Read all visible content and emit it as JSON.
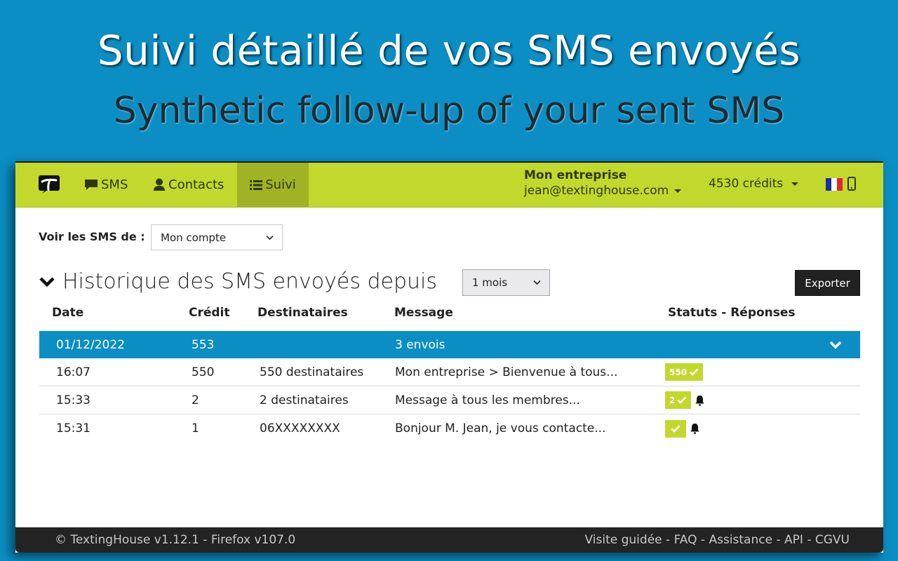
{
  "banner": {
    "title_fr": "Suivi détaillé de vos SMS envoyés",
    "title_en": "Synthetic follow-up of your sent SMS"
  },
  "navbar": {
    "logo": "textinghouse-logo",
    "items": [
      {
        "label": "SMS",
        "icon": "comment-icon",
        "active": false
      },
      {
        "label": "Contacts",
        "icon": "user-icon",
        "active": false
      },
      {
        "label": "Suivi",
        "icon": "list-icon",
        "active": true
      }
    ],
    "account": {
      "company": "Mon entreprise",
      "email": "jean@textinghouse.com"
    },
    "credits": "4530 crédits",
    "language_flag": "france-flag-icon",
    "mobile_icon": "mobile-phone-icon"
  },
  "filter": {
    "label": "Voir les SMS de :",
    "selected": "Mon compte"
  },
  "history": {
    "title": "Historique des SMS envoyés depuis",
    "period_selected": "1 mois",
    "export_label": "Exporter",
    "columns": [
      "Date",
      "Crédit",
      "Destinataires",
      "Message",
      "Statuts - Réponses"
    ],
    "group": {
      "date": "01/12/2022",
      "credit": "553",
      "message": "3 envois"
    },
    "rows": [
      {
        "time": "16:07",
        "credit": "550",
        "recipients": "550 destinataires",
        "message": "Mon entreprise > Bienvenue à tous...",
        "status_count": "550",
        "has_reply": false
      },
      {
        "time": "15:33",
        "credit": "2",
        "recipients": "2 destinataires",
        "message": "Message à tous les membres...",
        "status_count": "2",
        "has_reply": true
      },
      {
        "time": "15:31",
        "credit": "1",
        "recipients": "06XXXXXXXX",
        "message": "Bonjour M. Jean, je vous contacte...",
        "status_count": "",
        "has_reply": true
      }
    ]
  },
  "footer": {
    "version": "© TextingHouse v1.12.1 - Firefox v107.0",
    "links": [
      "Visite guidée",
      "FAQ",
      "Assistance",
      "API",
      "CGVU"
    ],
    "separator": " - "
  },
  "colors": {
    "banner_bg": "#0b8ec3",
    "navbar": "#c3d82d",
    "nav_active": "#a1b324",
    "group_row": "#0b8ec3",
    "badge": "#c3d82d",
    "footer": "#232323"
  }
}
